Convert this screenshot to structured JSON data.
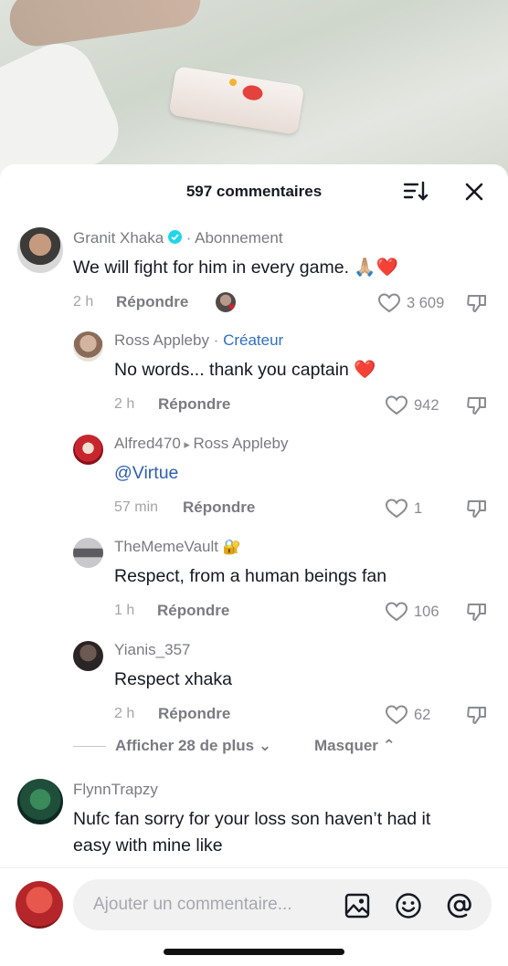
{
  "header": {
    "count_label": "597 commentaires",
    "sort_icon": "sort-icon",
    "close_icon": "close-icon"
  },
  "comments": [
    {
      "username": "Granit Xhaka",
      "verified": true,
      "sep": " · ",
      "follow_label": "Abonnement",
      "text": "We will fight for him in every game. 🙏🏼❤️",
      "time": "2 h",
      "reply_label": "Répondre",
      "likes": "3 609"
    },
    {
      "username": "Ross Appleby",
      "sep": " · ",
      "tag": "Créateur",
      "text": "No words... thank you captain ❤️",
      "time": "2 h",
      "reply_label": "Répondre",
      "likes": "942"
    },
    {
      "username": "Alfred470",
      "reply_arrow": " ▸ ",
      "reply_to": "Ross Appleby",
      "text": "@Virtue",
      "time": "57 min",
      "reply_label": "Répondre",
      "likes": "1"
    },
    {
      "username": "TheMemeVault",
      "lock_emoji": "🔐",
      "text": "Respect, from a human beings fan",
      "time": "1 h",
      "reply_label": "Répondre",
      "likes": "106"
    },
    {
      "username": "Yianis_357",
      "text": "Respect xhaka",
      "time": "2 h",
      "reply_label": "Répondre",
      "likes": "62"
    },
    {
      "username": "FlynnTrapzy",
      "text_line1": "Nufc fan sorry for your loss son haven’t had it",
      "text_line2": "easy with mine like"
    }
  ],
  "replies_controls": {
    "more_label": "Afficher 28 de plus ⌄",
    "hide_label": "Masquer ⌃"
  },
  "composer": {
    "placeholder": "Ajouter un commentaire...",
    "icons": [
      "image-icon",
      "emoji-icon",
      "mention-icon"
    ]
  },
  "colors": {
    "accent_link": "#2f6fbe",
    "verified": "#20d5ec",
    "heart": "#e8192c"
  }
}
